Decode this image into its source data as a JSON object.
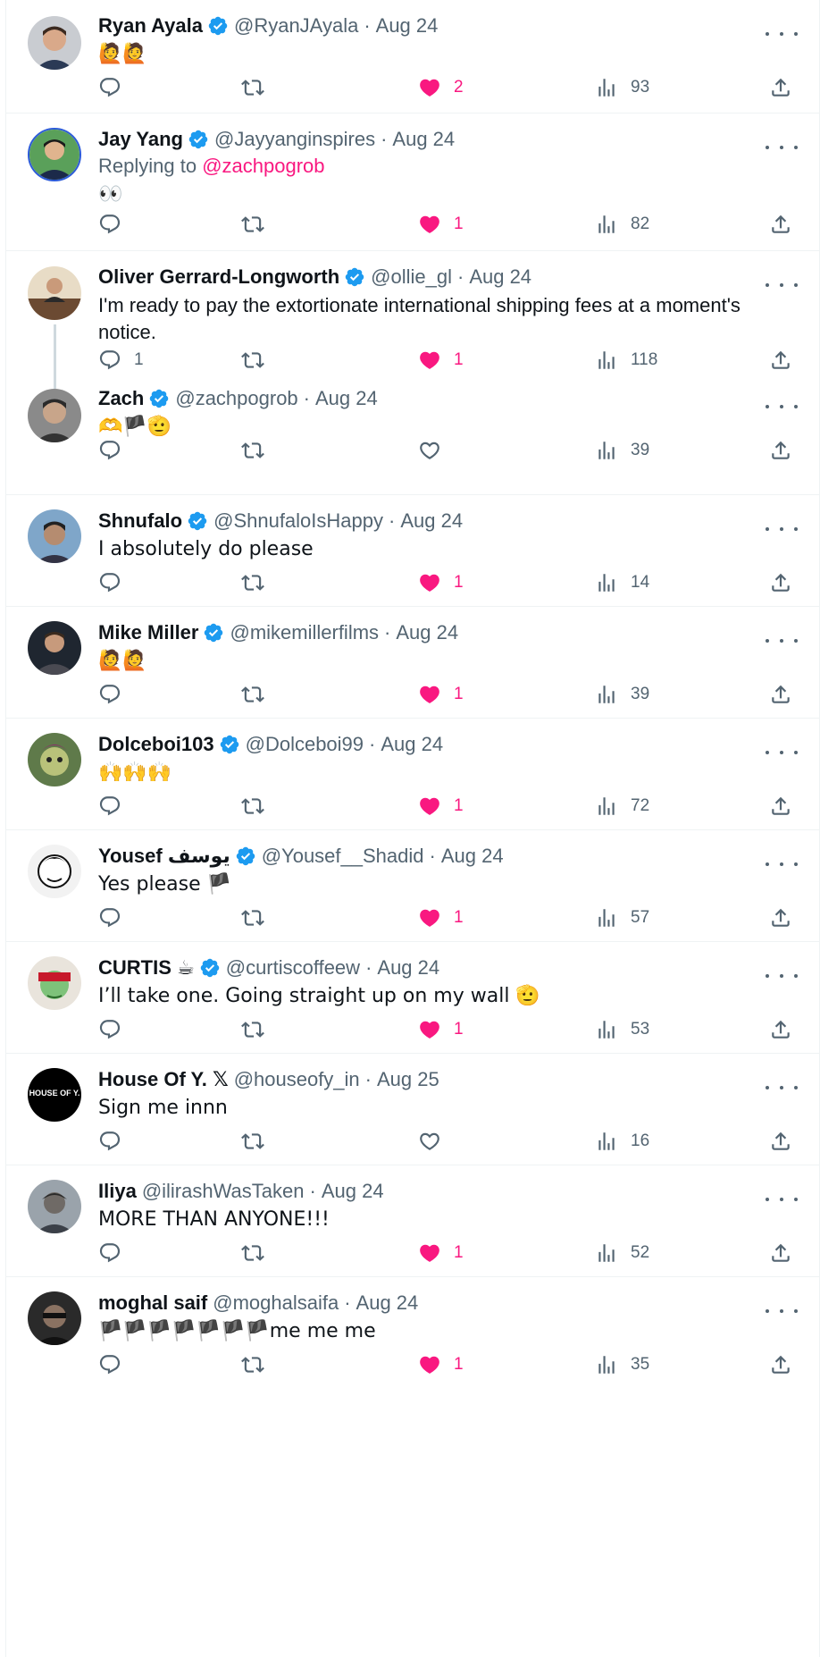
{
  "colors": {
    "accent": "#f91880",
    "verified": "#1d9bf0",
    "muted": "#536471",
    "text": "#0f1419"
  },
  "tweets": [
    {
      "name": "Ryan Ayala",
      "verified": true,
      "handle": "@RyanJAyala",
      "date": "Aug 24",
      "text": "🙋🙋",
      "replies": "",
      "likes": "2",
      "liked": true,
      "views": "93"
    },
    {
      "name": "Jay Yang",
      "verified": true,
      "handle": "@Jayyanginspires",
      "date": "Aug 24",
      "reply_prefix": "Replying to ",
      "reply_mention": "@zachpogrob",
      "text": "👀",
      "replies": "",
      "likes": "1",
      "liked": true,
      "views": "82"
    },
    {
      "name": "Oliver Gerrard-Longworth",
      "verified": true,
      "handle": "@ollie_gl",
      "date": "Aug 24",
      "text": "I'm ready to pay the extortionate international shipping fees at a moment's notice.",
      "replies": "1",
      "likes": "1",
      "liked": true,
      "views": "118"
    },
    {
      "name": "Zach",
      "verified": true,
      "handle": "@zachpogrob",
      "date": "Aug 24",
      "text": "🫶🏴🫡",
      "replies": "",
      "likes": "",
      "liked": false,
      "views": "39"
    },
    {
      "name": "Shnufalo",
      "verified": true,
      "handle": "@ShnufaloIsHappy",
      "date": "Aug 24",
      "text": "I absolutely do please",
      "replies": "",
      "likes": "1",
      "liked": true,
      "views": "14"
    },
    {
      "name": "Mike Miller",
      "verified": true,
      "handle": "@mikemillerfilms",
      "date": "Aug 24",
      "text": "🙋🙋",
      "replies": "",
      "likes": "1",
      "liked": true,
      "views": "39"
    },
    {
      "name": "Dolceboi103",
      "verified": true,
      "handle": "@Dolceboi99",
      "date": "Aug 24",
      "text": "🙌🙌🙌",
      "replies": "",
      "likes": "1",
      "liked": true,
      "views": "72"
    },
    {
      "name": "Yousef يوسف",
      "verified": true,
      "handle": "@Yousef__Shadid",
      "date": "Aug 24",
      "text": "Yes please 🏴",
      "replies": "",
      "likes": "1",
      "liked": true,
      "views": "57"
    },
    {
      "name": "CURTIS ☕",
      "verified": true,
      "handle": "@curtiscoffeew",
      "date": "Aug 24",
      "text": "I’ll take one. Going straight up on my wall 🫡",
      "replies": "",
      "likes": "1",
      "liked": true,
      "views": "53"
    },
    {
      "name": "House Of Y. 𝕏",
      "verified": false,
      "handle": "@houseofy_in",
      "date": "Aug 25",
      "text": "Sign me innn",
      "replies": "",
      "likes": "",
      "liked": false,
      "views": "16",
      "avatar_text": "HOUSE OF Y."
    },
    {
      "name": "Iliya",
      "verified": false,
      "handle": "@ilirashWasTaken",
      "date": "Aug 24",
      "text": "MORE THAN ANYONE!!!",
      "replies": "",
      "likes": "1",
      "liked": true,
      "views": "52"
    },
    {
      "name": "moghal saif",
      "verified": false,
      "handle": "@moghalsaifa",
      "date": "Aug 24",
      "text": "🏴🏴🏴🏴🏴🏴🏴me me me",
      "replies": "",
      "likes": "1",
      "liked": true,
      "views": "35"
    }
  ]
}
